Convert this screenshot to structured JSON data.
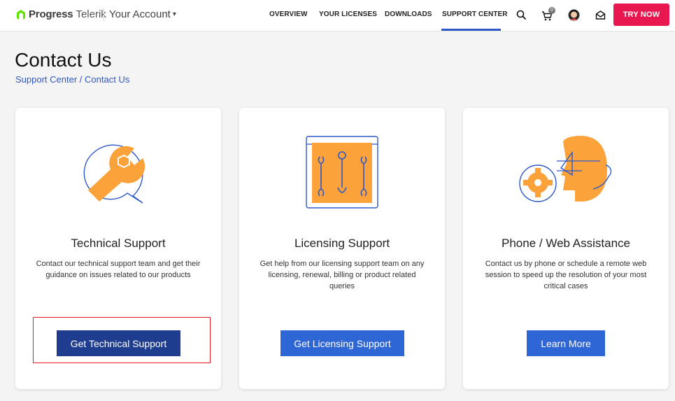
{
  "header": {
    "brand_primary": "Progress",
    "brand_secondary": "Telerik",
    "account_label": "Your Account",
    "nav": [
      "OVERVIEW",
      "YOUR LICENSES",
      "DOWNLOADS",
      "SUPPORT CENTER"
    ],
    "active_nav": "SUPPORT CENTER",
    "cart_count": "0",
    "try_label": "TRY NOW",
    "icons": [
      "search-icon",
      "cart-icon",
      "avatar",
      "mail-icon"
    ]
  },
  "page": {
    "title": "Contact Us",
    "breadcrumb": [
      "Support Center",
      "Contact Us"
    ],
    "breadcrumb_sep": "/"
  },
  "cards": [
    {
      "title": "Technical Support",
      "description": "Contact our technical support team and get their guidance on issues related to our products",
      "button": "Get Technical Support",
      "icon": "wrench-speech-icon"
    },
    {
      "title": "Licensing Support",
      "description": "Get help from our licensing support team on any licensing, renewal, billing or product related queries",
      "button": "Get Licensing Support",
      "icon": "tools-panel-icon"
    },
    {
      "title": "Phone / Web Assistance",
      "description": "Contact us by phone or schedule a remote web session to speed up the resolution of your most critical cases",
      "button": "Learn More",
      "icon": "headset-agent-icon"
    }
  ],
  "colors": {
    "accent_blue": "#2d58c9",
    "button_dark": "#1f3d8f",
    "button_blue": "#2f66d5",
    "try_red": "#e8174f",
    "icon_orange": "#fba23a",
    "highlight_red": "#e21e28"
  }
}
